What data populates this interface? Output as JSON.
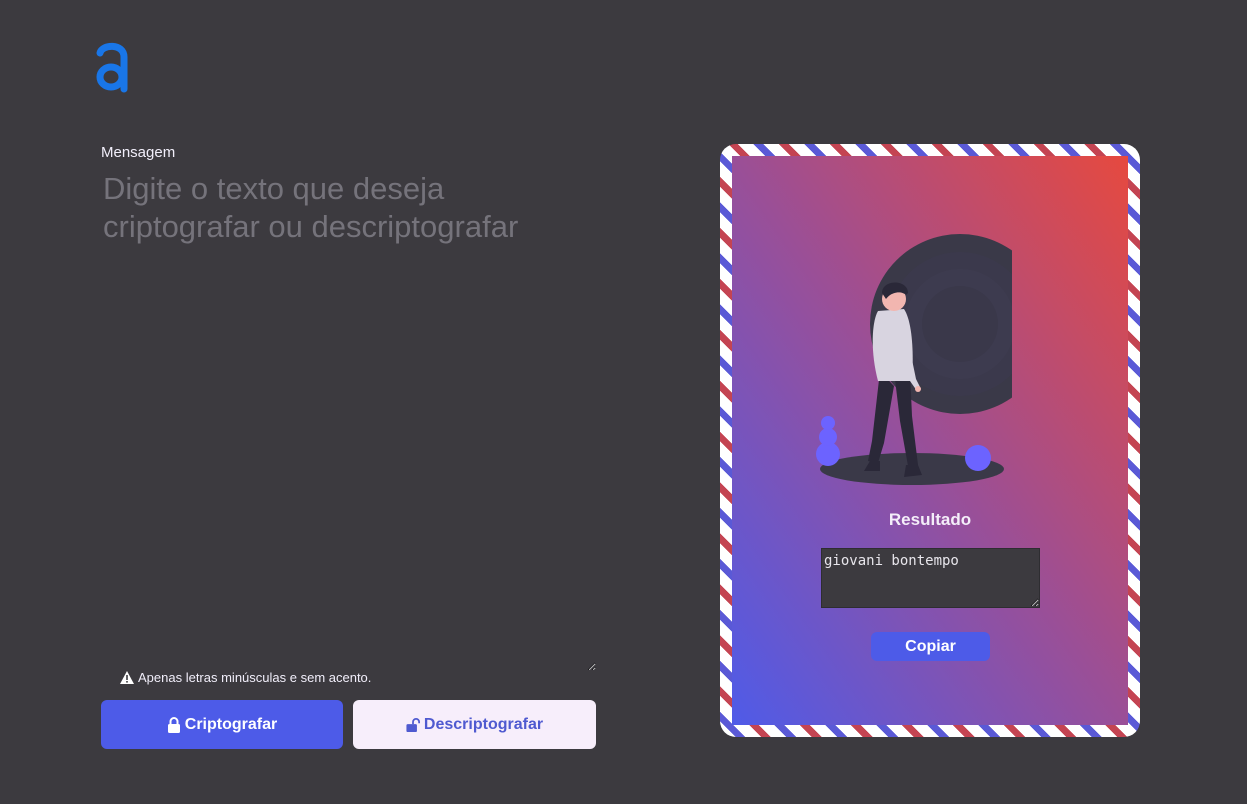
{
  "app": {
    "logo_letter": "a",
    "accent_color": "#1976e8"
  },
  "message": {
    "label": "Mensagem",
    "placeholder": "Digite o texto que deseja criptografar ou descriptografar",
    "value": ""
  },
  "hint": {
    "icon": "warning-icon",
    "text": "Apenas letras minúsculas e sem acento."
  },
  "actions": {
    "encrypt_label": "Criptografar",
    "encrypt_icon": "lock-icon",
    "decrypt_label": "Descriptografar",
    "decrypt_icon": "unlock-icon",
    "encrypt_color": "#4d5be8",
    "decrypt_color": "#f7eefb"
  },
  "result": {
    "title": "Resultado",
    "value": "giovani bontempo",
    "copy_label": "Copiar"
  }
}
